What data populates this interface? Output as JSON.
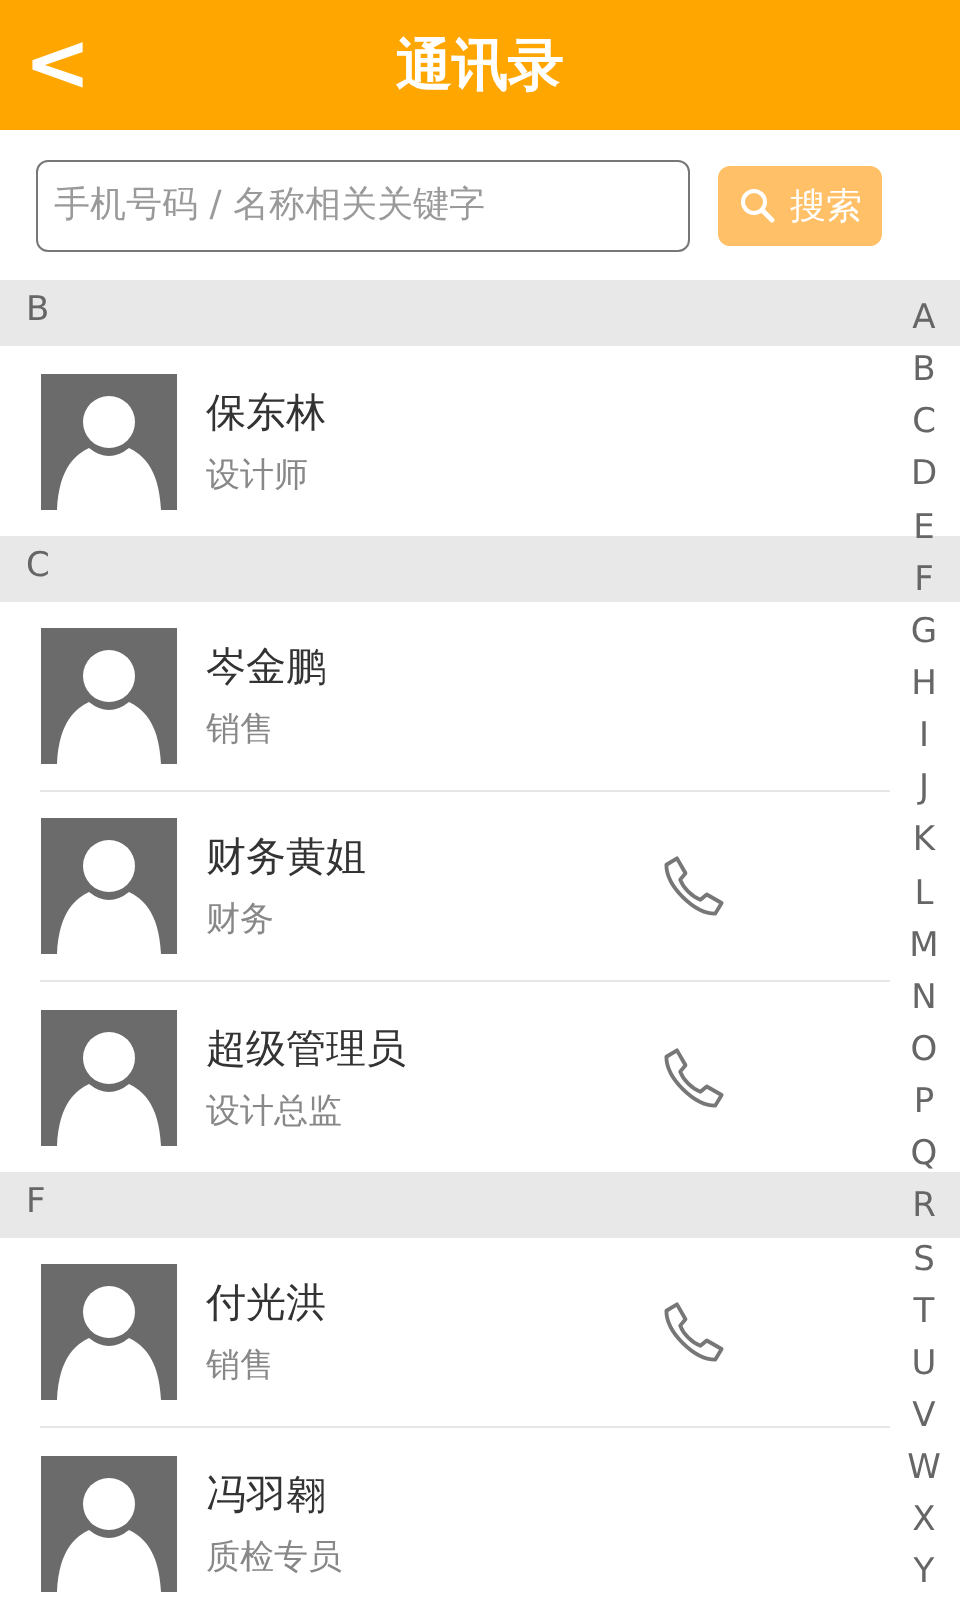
{
  "header": {
    "back": "<",
    "title": "通讯录"
  },
  "search": {
    "placeholder": "手机号码 / 名称相关关键字",
    "button": "搜索"
  },
  "sections": [
    {
      "letter": "B",
      "contacts": [
        {
          "name": "保东林",
          "role": "设计师",
          "call": false
        }
      ]
    },
    {
      "letter": "C",
      "contacts": [
        {
          "name": "岑金鹏",
          "role": "销售",
          "call": false
        },
        {
          "name": "财务黄姐",
          "role": "财务",
          "call": true
        },
        {
          "name": "超级管理员",
          "role": "设计总监",
          "call": true
        }
      ]
    },
    {
      "letter": "F",
      "contacts": [
        {
          "name": "付光洪",
          "role": "销售",
          "call": true
        },
        {
          "name": "冯羽翱",
          "role": "质检专员",
          "call": false
        }
      ]
    }
  ],
  "index": [
    "A",
    "B",
    "C",
    "D",
    "E",
    "F",
    "G",
    "H",
    "I",
    "J",
    "K",
    "L",
    "M",
    "N",
    "O",
    "P",
    "Q",
    "R",
    "S",
    "T",
    "U",
    "V",
    "W",
    "X",
    "Y"
  ]
}
